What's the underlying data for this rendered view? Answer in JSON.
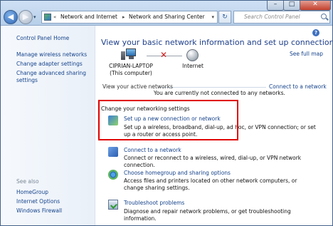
{
  "window": {
    "minimize_glyph": "–",
    "maximize_glyph": "□",
    "close_glyph": "✕"
  },
  "address_bar": {
    "chevron": "«",
    "segments": [
      "Network and Internet",
      "Network and Sharing Center"
    ],
    "separator": "▸",
    "dropdown": "▾",
    "refresh_glyph": "↻"
  },
  "search": {
    "placeholder": "Search Control Panel"
  },
  "sidebar": {
    "home": "Control Panel Home",
    "links": [
      "Manage wireless networks",
      "Change adapter settings",
      "Change advanced sharing settings"
    ],
    "see_also_heading": "See also",
    "see_also": [
      "HomeGroup",
      "Internet Options",
      "Windows Firewall"
    ]
  },
  "main": {
    "help_glyph": "?",
    "title": "View your basic network information and set up connections",
    "see_full_map": "See full map",
    "computer_name": "CIPRIAN-LAPTOP",
    "computer_sub": "(This computer)",
    "internet_label": "Internet",
    "disconnect_glyph": "✕",
    "active_networks_label": "View your active networks",
    "connect_to_network_link": "Connect to a network",
    "not_connected": "You are currently not connected to any networks.",
    "settings_heading": "Change your networking settings",
    "items": [
      {
        "title": "Set up a new connection or network",
        "desc": "Set up a wireless, broadband, dial-up, ad hoc, or VPN connection; or set up a router or access point."
      },
      {
        "title": "Connect to a network",
        "desc": "Connect or reconnect to a wireless, wired, dial-up, or VPN network connection."
      },
      {
        "title": "Choose homegroup and sharing options",
        "desc": "Access files and printers located on other network computers, or change sharing settings."
      },
      {
        "title": "Troubleshoot problems",
        "desc": "Diagnose and repair network problems, or get troubleshooting information."
      }
    ]
  },
  "colors": {
    "link": "#15428b",
    "title": "#1e3f8a",
    "highlight_box": "#e00000"
  }
}
